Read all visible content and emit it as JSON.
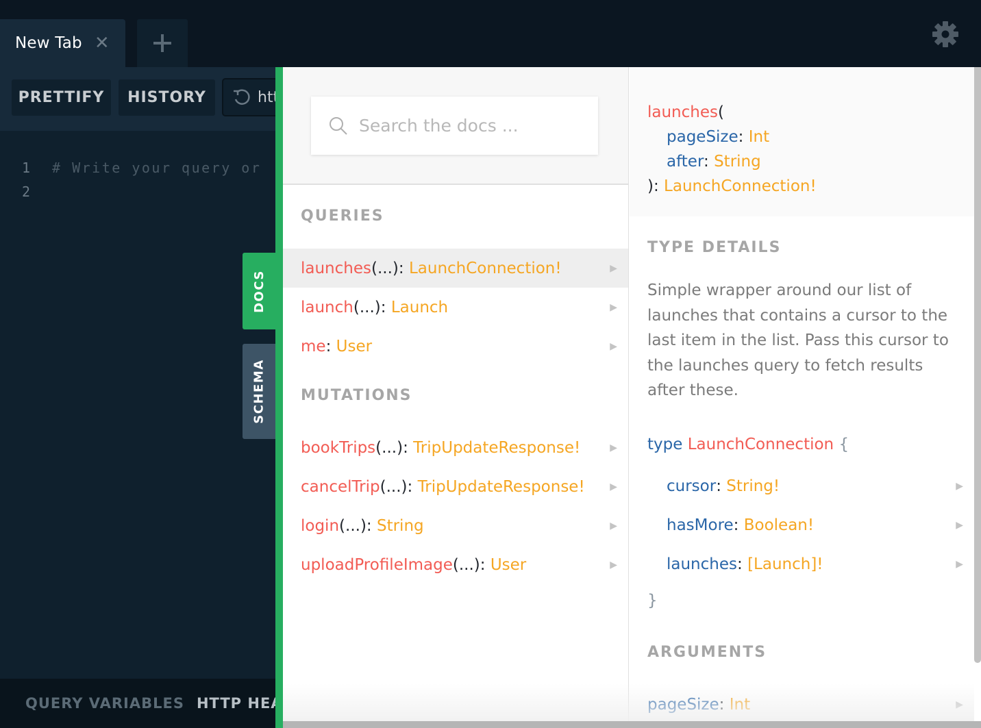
{
  "tabs": [
    {
      "label": "New Tab",
      "close_icon": "close-icon"
    }
  ],
  "add_tab_icon": "plus-icon",
  "settings_icon": "gear-icon",
  "toolbar": {
    "prettify_label": "PRETTIFY",
    "history_label": "HISTORY",
    "url_value": "htt",
    "reload_icon": "reload-icon"
  },
  "editor": {
    "lines": [
      {
        "number": "1",
        "text": "# Write your query or"
      },
      {
        "number": "2",
        "text": ""
      }
    ]
  },
  "bottom_bar": {
    "query_variables_label": "QUERY VARIABLES",
    "http_headers_label": "HTTP HEA"
  },
  "side_tabs": {
    "docs_label": "DOCS",
    "schema_label": "SCHEMA"
  },
  "docs": {
    "search_placeholder": "Search the docs ...",
    "queries_title": "QUERIES",
    "queries": [
      {
        "name": "launches",
        "args": "(...)",
        "sep": ": ",
        "type": "LaunchConnection!",
        "active": true
      },
      {
        "name": "launch",
        "args": "(...)",
        "sep": ": ",
        "type": "Launch",
        "active": false
      },
      {
        "name": "me",
        "args": "",
        "sep": ": ",
        "type": "User",
        "active": false
      }
    ],
    "mutations_title": "MUTATIONS",
    "mutations": [
      {
        "name": "bookTrips",
        "args": "(...)",
        "sep": ": ",
        "type": "TripUpdateResponse!"
      },
      {
        "name": "cancelTrip",
        "args": "(...)",
        "sep": ": ",
        "type": "TripUpdateResponse!"
      },
      {
        "name": "login",
        "args": "(...)",
        "sep": ": ",
        "type": "String"
      },
      {
        "name": "uploadProfileImage",
        "args": "(...)",
        "sep": ": ",
        "type": "User"
      }
    ]
  },
  "detail": {
    "signature": {
      "name": "launches",
      "open": "(",
      "args": [
        {
          "name": "pageSize",
          "sep": ": ",
          "type": "Int"
        },
        {
          "name": "after",
          "sep": ": ",
          "type": "String"
        }
      ],
      "close": "): ",
      "return_type": "LaunchConnection!"
    },
    "type_details_title": "TYPE DETAILS",
    "description": "Simple wrapper around our list of launches that contains a cursor to the last item in the list. Pass this cursor to the launches query to fetch results after these.",
    "type_keyword": "type",
    "type_name": "LaunchConnection",
    "open_brace": "{",
    "close_brace": "}",
    "fields": [
      {
        "name": "cursor",
        "sep": ": ",
        "type": "String!"
      },
      {
        "name": "hasMore",
        "sep": ": ",
        "type": "Boolean!"
      },
      {
        "name": "launches",
        "sep": ": ",
        "type": "[Launch]!"
      }
    ],
    "arguments_title": "ARGUMENTS",
    "arguments": [
      {
        "name": "pageSize",
        "sep": ": ",
        "type": "Int"
      }
    ]
  },
  "colors": {
    "accent_green": "#27ae60",
    "field_name": "#f25c54",
    "type_name": "#f5a623",
    "arg_name": "#2a66a8",
    "background_dark": "#0b1621"
  }
}
